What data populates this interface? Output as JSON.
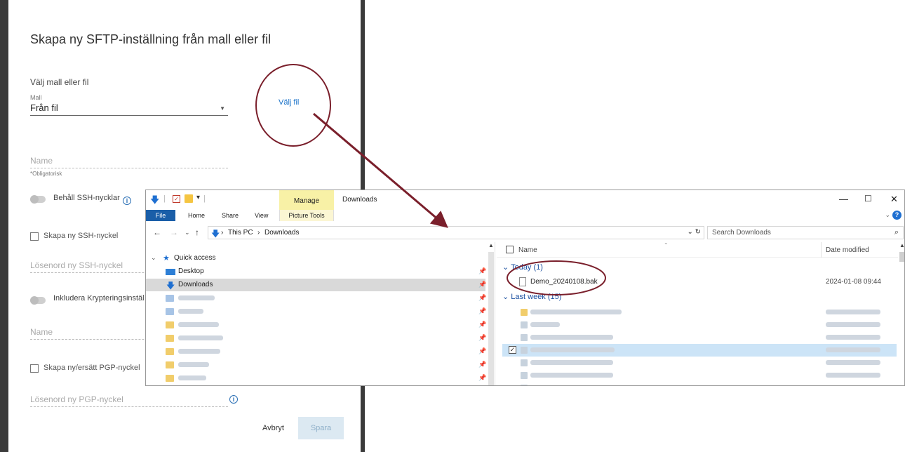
{
  "dialog": {
    "title": "Skapa ny SFTP-inställning från mall eller fil",
    "section_label": "Välj mall eller fil",
    "mall_label": "Mall",
    "mall_value": "Från fil",
    "choose_file": "Välj fil",
    "name_placeholder": "Name",
    "required_hint": "*Obligatorisk",
    "keep_ssh_keys": "Behåll SSH-nycklar",
    "create_ssh_key": "Skapa ny SSH-nyckel",
    "ssh_password_placeholder": "Lösenord ny SSH-nyckel",
    "include_encryption": "Inkludera Krypteringsinstäl",
    "name2_placeholder": "Name",
    "create_pgp_key": "Skapa ny/ersätt PGP-nyckel",
    "pgp_password_placeholder": "Lösenord ny PGP-nyckel",
    "cancel": "Avbryt",
    "save": "Spara"
  },
  "explorer": {
    "manage_tab": "Manage",
    "window_title": "Downloads",
    "ribbon_tabs": [
      "File",
      "Home",
      "Share",
      "View"
    ],
    "picture_tools": "Picture Tools",
    "breadcrumb": [
      "This PC",
      "Downloads"
    ],
    "search_placeholder": "Search Downloads",
    "nav": {
      "quick_access": "Quick access",
      "desktop": "Desktop",
      "downloads": "Downloads"
    },
    "columns": {
      "name": "Name",
      "date": "Date modified"
    },
    "groups": {
      "today": "Today (1)",
      "last_week": "Last week (15)"
    },
    "files": [
      {
        "name": "Demo_20240108.bak",
        "date": "2024-01-08 09:44"
      }
    ]
  },
  "icons": {
    "minimize": "minimize-icon",
    "maximize": "maximize-icon",
    "close": "close-icon",
    "info": "info-icon",
    "search": "search-icon",
    "help": "help-icon"
  },
  "colors": {
    "link": "#1a73c9",
    "file_tab": "#1a5ea8",
    "manage_tab": "#f8f1a6",
    "annotation": "#7a1f2b",
    "selection": "#cce4f7"
  }
}
